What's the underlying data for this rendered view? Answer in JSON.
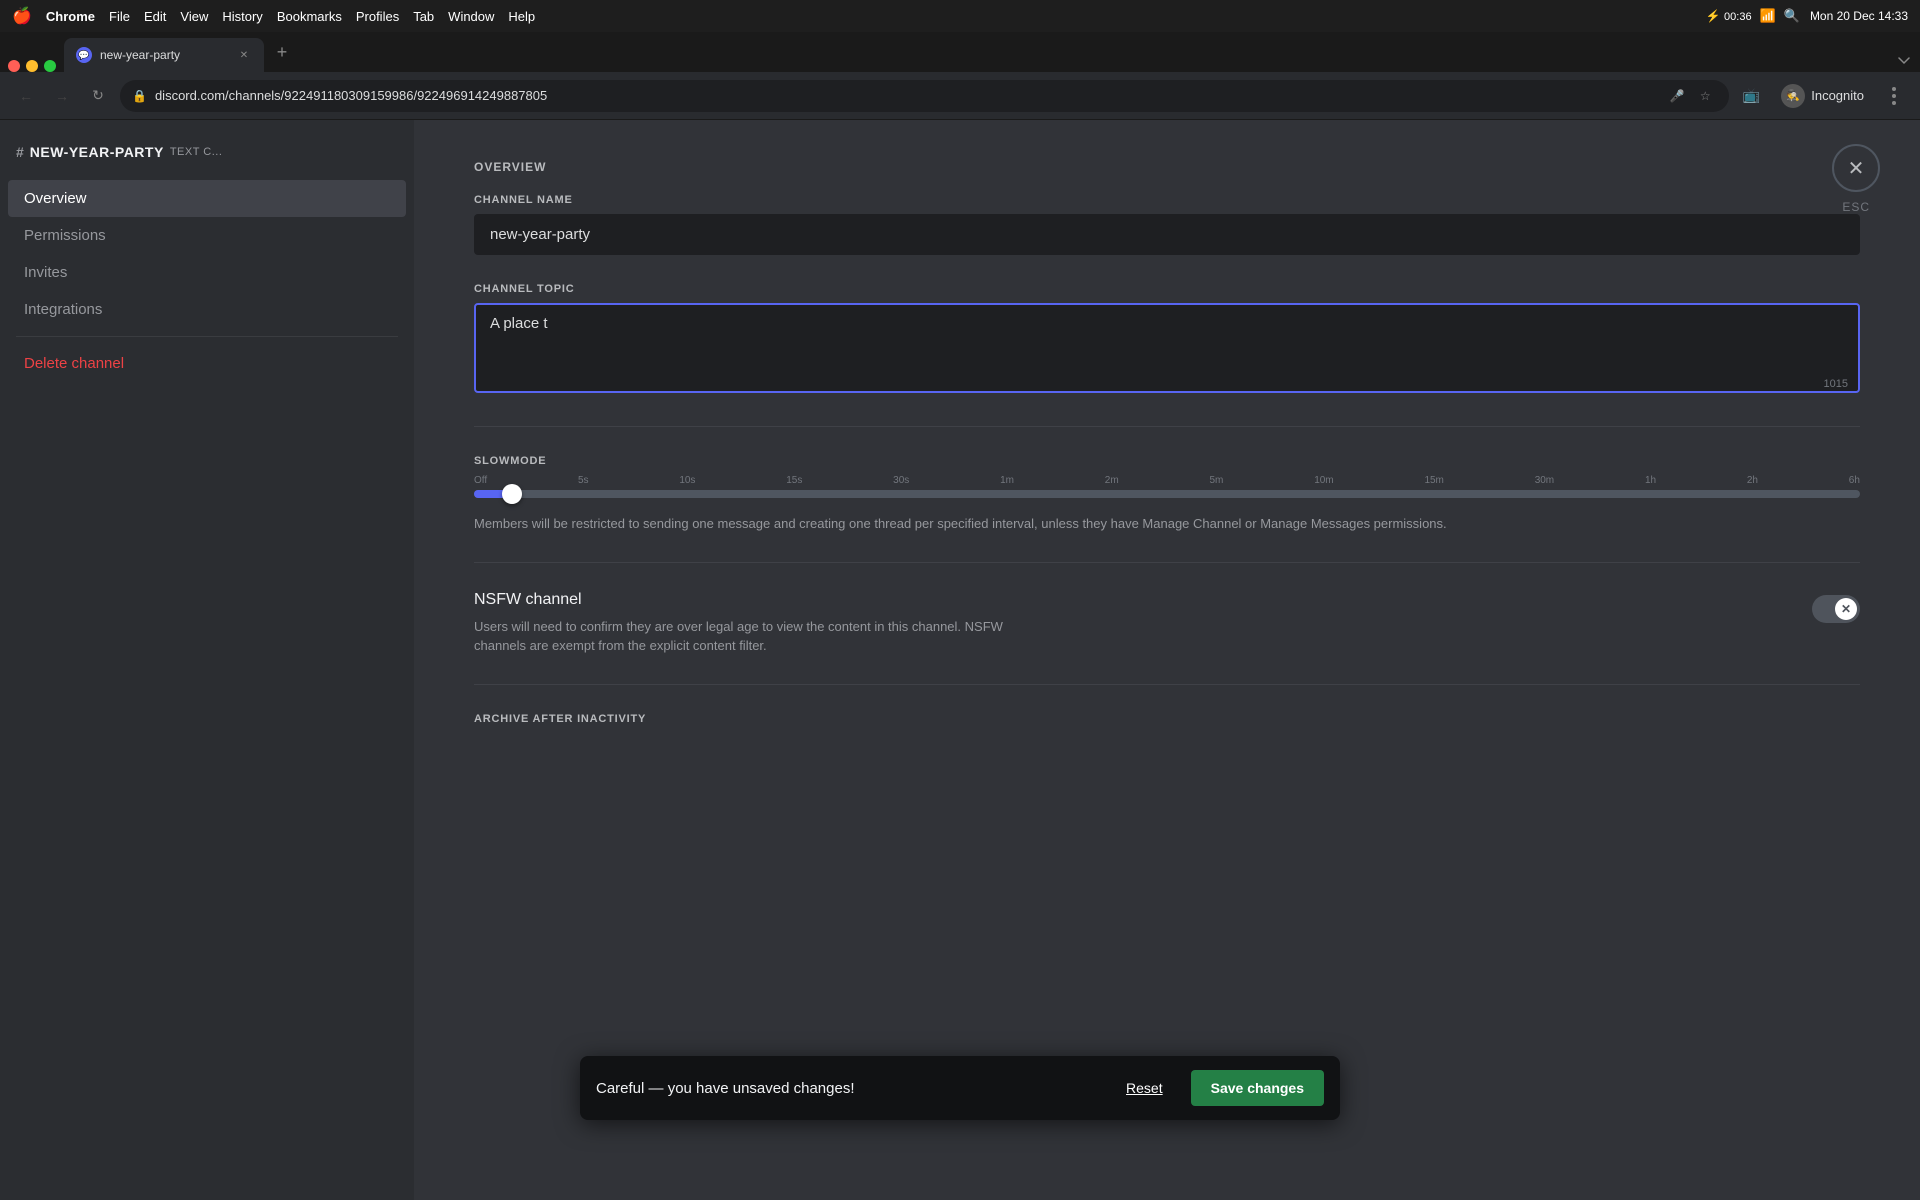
{
  "menubar": {
    "apple": "🍎",
    "items": [
      "Chrome",
      "File",
      "Edit",
      "View",
      "History",
      "Bookmarks",
      "Profiles",
      "Tab",
      "Window",
      "Help"
    ],
    "time": "Mon 20 Dec  14:33",
    "battery": "00:36"
  },
  "browser": {
    "tab": {
      "title": "new-year-party",
      "url": "discord.com/channels/922491180309159986/922496914249887805"
    }
  },
  "sidebar": {
    "channel_header": "# NEW-YEAR-PARTY",
    "channel_type": "TEXT C...",
    "items": [
      {
        "label": "Overview",
        "active": true
      },
      {
        "label": "Permissions",
        "active": false
      },
      {
        "label": "Invites",
        "active": false
      },
      {
        "label": "Integrations",
        "active": false
      }
    ],
    "delete_label": "Delete channel"
  },
  "settings": {
    "title": "OVERVIEW",
    "channel_name_label": "CHANNEL NAME",
    "channel_name_value": "new-year-party",
    "channel_topic_label": "CHANNEL TOPIC",
    "channel_topic_value": "A place t",
    "channel_topic_char_count": "1015",
    "slowmode_label": "SLOWMODE",
    "slowmode_ticks": [
      "Off",
      "5s",
      "10s",
      "15s",
      "30s",
      "1m",
      "2m",
      "5m",
      "10m",
      "15m",
      "30m",
      "1h",
      "2h",
      "6h"
    ],
    "slowmode_desc": "Members will be restricted to sending one message and creating one thread per specified interval, unless they have Manage Channel or Manage Messages permissions.",
    "nsfw_title": "NSFW channel",
    "nsfw_desc": "Users will need to confirm they are over legal age to view the content in this channel. NSFW channels are exempt from the explicit content filter.",
    "archive_label": "ARCHIVE AFTER INACTIVITY",
    "close_label": "ESC"
  },
  "unsaved_bar": {
    "message": "Careful — you have unsaved changes!",
    "reset_label": "Reset",
    "save_label": "Save changes"
  }
}
